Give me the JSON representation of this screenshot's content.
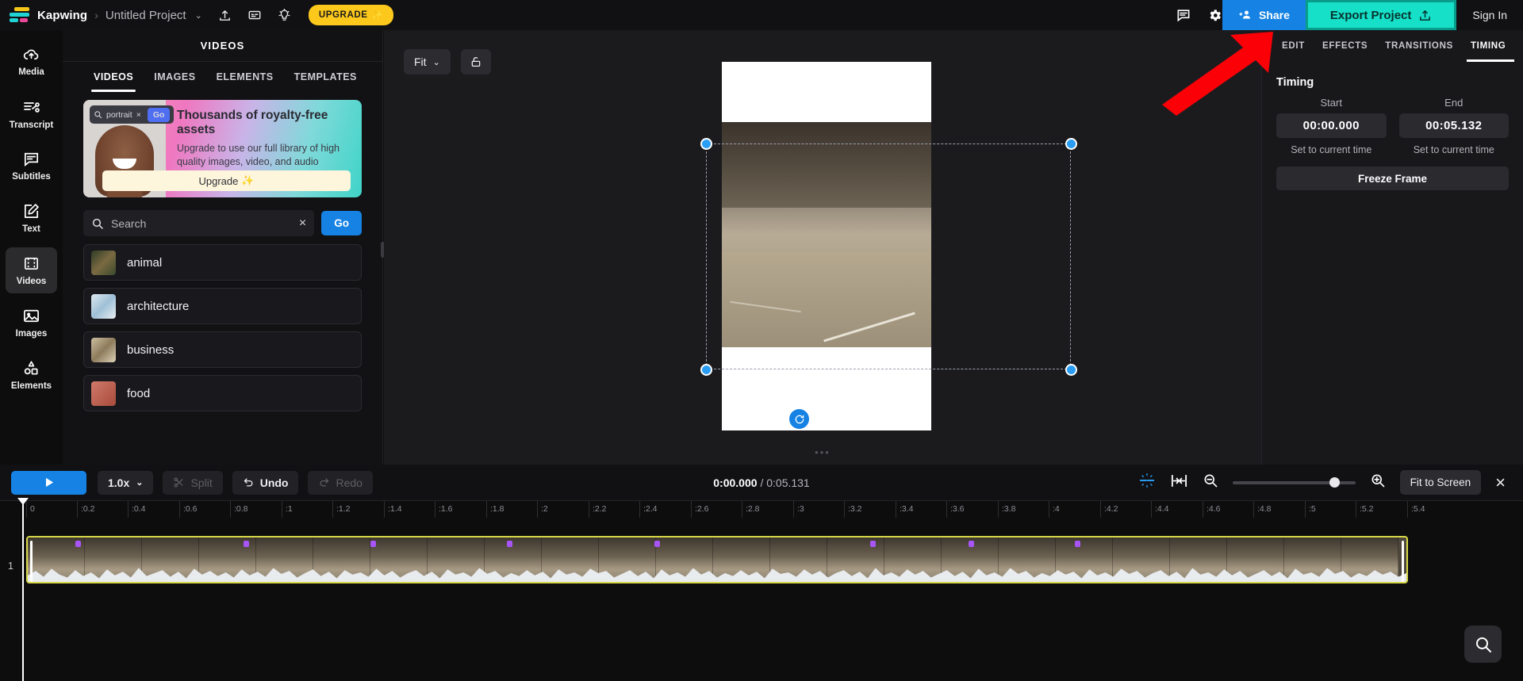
{
  "header": {
    "brand": "Kapwing",
    "breadcrumb_separator": "›",
    "project_name": "Untitled Project",
    "project_chevron": "⌄",
    "upload_icon": "upload-icon",
    "captions_icon": "captions-icon",
    "idea_icon": "lightbulb-icon",
    "upgrade_label": "UPGRADE",
    "upgrade_sparkle": "✨",
    "comment_icon": "comment-icon",
    "settings_icon": "gear-icon",
    "share_label": "Share",
    "share_icon": "add-person-icon",
    "export_label": "Export Project",
    "export_icon": "share-out-icon",
    "signin_label": "Sign In"
  },
  "rail": {
    "items": [
      {
        "label": "Media",
        "icon": "cloud-upload-icon",
        "active": false
      },
      {
        "label": "Transcript",
        "icon": "transcript-icon",
        "active": false
      },
      {
        "label": "Subtitles",
        "icon": "subtitles-icon",
        "active": false
      },
      {
        "label": "Text",
        "icon": "text-edit-icon",
        "active": false
      },
      {
        "label": "Videos",
        "icon": "film-icon",
        "active": true
      },
      {
        "label": "Images",
        "icon": "image-icon",
        "active": false
      },
      {
        "label": "Elements",
        "icon": "elements-icon",
        "active": false
      }
    ]
  },
  "panel": {
    "title": "VIDEOS",
    "collapse_icon": "collapse-left-icon",
    "tabs": [
      {
        "label": "VIDEOS",
        "active": true
      },
      {
        "label": "IMAGES",
        "active": false
      },
      {
        "label": "ELEMENTS",
        "active": false
      },
      {
        "label": "TEMPLATES",
        "active": false
      }
    ],
    "promo": {
      "mini_search_term": "portrait",
      "mini_search_clear": "×",
      "mini_go_label": "Go",
      "heading": "Thousands of royalty-free assets",
      "body": "Upgrade to use our full library of high quality images, video, and audio",
      "button_label": "Upgrade",
      "button_sparkle": "✨"
    },
    "search": {
      "placeholder": "Search",
      "clear_icon": "×",
      "go_label": "Go"
    },
    "categories": [
      {
        "label": "animal",
        "swatch": "#4a5a3c"
      },
      {
        "label": "architecture",
        "swatch": "#aec6d8"
      },
      {
        "label": "business",
        "swatch": "#b9a98a"
      },
      {
        "label": "food",
        "swatch": "#c06a6a"
      }
    ]
  },
  "canvas": {
    "fit_label": "Fit",
    "fit_chevron": "⌄",
    "lock_icon": "unlock-icon",
    "rotate_icon": "rotate-icon",
    "grip_icon": "drag-grip"
  },
  "right": {
    "tabs": [
      {
        "label": "EDIT",
        "active": false
      },
      {
        "label": "EFFECTS",
        "active": false
      },
      {
        "label": "TRANSITIONS",
        "active": false
      },
      {
        "label": "TIMING",
        "active": true
      }
    ],
    "section_title": "Timing",
    "start_label": "Start",
    "end_label": "End",
    "start_value": "00:00.000",
    "end_value": "00:05.132",
    "start_set_label": "Set to current time",
    "end_set_label": "Set to current time",
    "freeze_label": "Freeze Frame"
  },
  "toolbar": {
    "play_icon": "play-icon",
    "speed_label": "1.0x",
    "speed_chevron": "⌄",
    "split_label": "Split",
    "split_icon": "scissors-icon",
    "undo_label": "Undo",
    "undo_icon": "undo-icon",
    "redo_label": "Redo",
    "redo_icon": "redo-icon",
    "current_time": "0:00.000",
    "time_separator": " / ",
    "total_time": "0:05.131",
    "snap_icon": "snap-icon",
    "fit_clip_icon": "fit-clip-icon",
    "zoom_out_icon": "zoom-out-icon",
    "zoom_in_icon": "zoom-in-icon",
    "fit_screen_label": "Fit to Screen",
    "close_icon": "×",
    "magnifier_icon": "search-icon"
  },
  "timeline": {
    "ruler_ticks": [
      "0",
      ":0.2",
      ":0.4",
      ":0.6",
      ":0.8",
      ":1",
      ":1.2",
      ":1.4",
      ":1.6",
      ":1.8",
      ":2",
      ":2.2",
      ":2.4",
      ":2.6",
      ":2.8",
      ":3",
      ":3.2",
      ":3.4",
      ":3.6",
      ":3.8",
      ":4",
      ":4.2",
      ":4.4",
      ":4.6",
      ":4.8",
      ":5",
      ":5.2",
      ":5.4"
    ],
    "track_number": "1"
  }
}
